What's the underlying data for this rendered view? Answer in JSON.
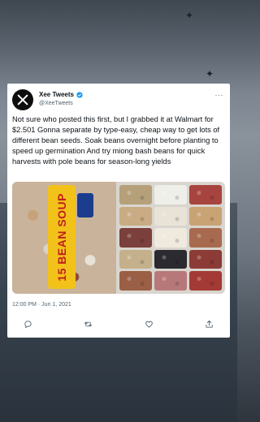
{
  "tweet": {
    "display_name": "Xee Tweets",
    "handle": "@XeeTweets",
    "text": "Not sure who posted this first, but I grabbed it at Walmart for $2.501 Gonna separate by type-easy, cheap way to get lots of different bean seeds. Soak beans overnight before planting to speed up germination And try miong bash beans for quick harvests with pole beans for season-long yields",
    "timestamp": "12:00 PM · Jun 1, 2021",
    "photo_label": "15 BEAN SOUP",
    "more_label": "···"
  },
  "icons": {
    "avatar": "x-logo-icon",
    "verified": "verified-badge-icon",
    "reply": "reply-icon",
    "retweet": "retweet-icon",
    "like": "heart-icon",
    "share": "share-icon"
  },
  "colors": {
    "card": "#ffffff",
    "text": "#0f1419",
    "secondary": "#536471",
    "verified": "#1d9bf0",
    "bean_label": "#f2c21a",
    "bean_label_text": "#c21e1e"
  },
  "bean_colors": [
    "#b5a07a",
    "#efefe9",
    "#a8443f",
    "#c9ac84",
    "#e8e3d6",
    "#c9a373",
    "#7b3f3c",
    "#efe9de",
    "#a86a4e",
    "#c4b08a",
    "#2a2a2f",
    "#8c3b36",
    "#9b5f46",
    "#b7787a",
    "#a33a36"
  ]
}
